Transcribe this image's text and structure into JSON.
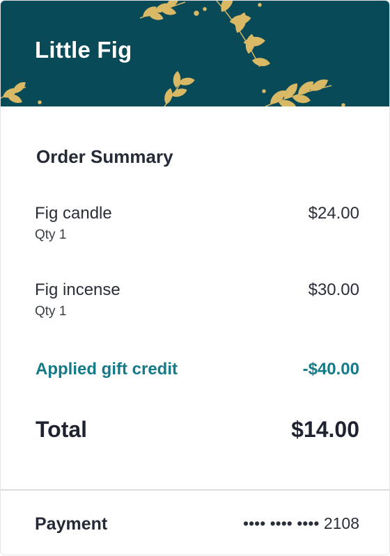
{
  "brand": {
    "name": "Little Fig",
    "banner_color": "#084a57",
    "leaf_color": "#d9b866"
  },
  "summary": {
    "title": "Order Summary",
    "items": [
      {
        "name": "Fig candle",
        "qty": "Qty 1",
        "price": "$24.00"
      },
      {
        "name": "Fig incense",
        "qty": "Qty 1",
        "price": "$30.00"
      }
    ],
    "credit": {
      "label": "Applied gift credit",
      "amount": "-$40.00",
      "color": "#137a86"
    },
    "total": {
      "label": "Total",
      "amount": "$14.00"
    }
  },
  "payment": {
    "label": "Payment",
    "value": "•••• •••• •••• 2108"
  }
}
